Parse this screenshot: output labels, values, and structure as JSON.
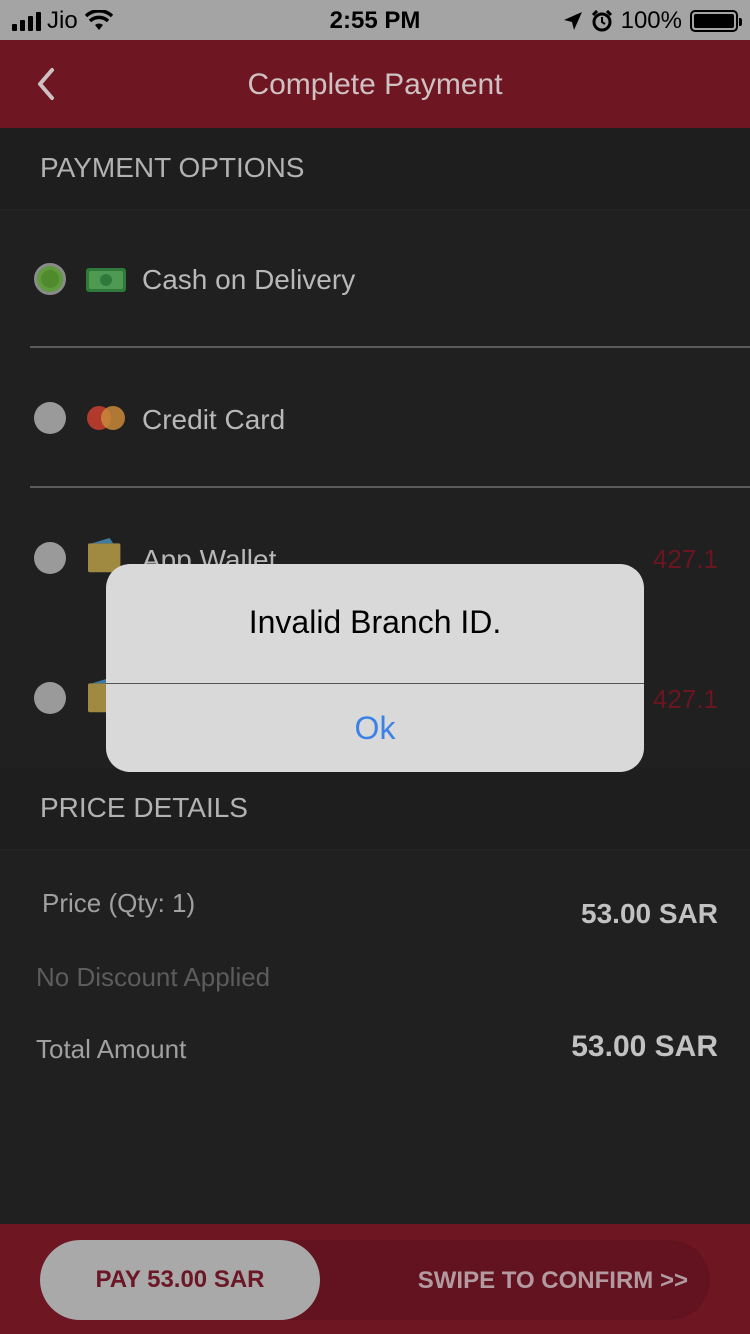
{
  "status_bar": {
    "carrier": "Jio",
    "time": "2:55 PM",
    "battery": "100%"
  },
  "header": {
    "title": "Complete Payment"
  },
  "payment": {
    "section_title": "PAYMENT OPTIONS",
    "options": [
      {
        "label": "Cash on Delivery",
        "selected": true
      },
      {
        "label": "Credit Card",
        "selected": false
      },
      {
        "label": "App Wallet",
        "amount": "427.1",
        "selected": false
      },
      {
        "label": "",
        "amount": "427.1",
        "selected": false
      }
    ]
  },
  "price_details": {
    "section_title": "PRICE DETAILS",
    "price_label": "Price (Qty: 1)",
    "price_value": "53.00 SAR",
    "discount_label": "No Discount Applied",
    "total_label": "Total Amount",
    "total_value": "53.00 SAR"
  },
  "footer": {
    "pay_label": "PAY 53.00 SAR",
    "swipe_label": "SWIPE TO CONFIRM >>"
  },
  "alert": {
    "message": "Invalid Branch ID.",
    "ok_label": "Ok"
  },
  "colors": {
    "brand": "#6e1722",
    "accent_link": "#3b82e8",
    "selected_radio": "#5f9a3e"
  }
}
